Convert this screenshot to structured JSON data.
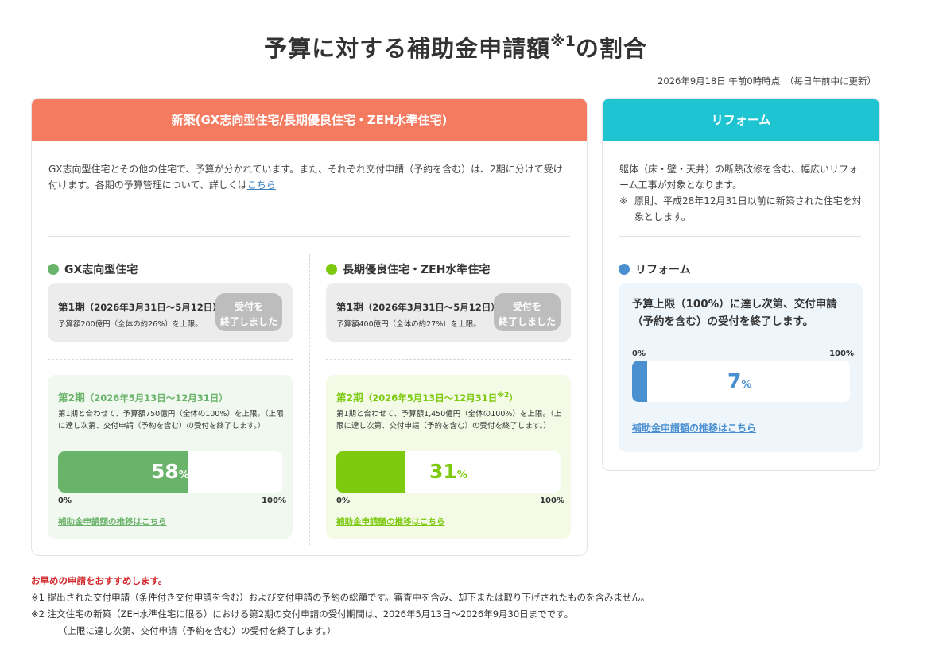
{
  "page": {
    "title_main": "予算に対する補助金申請額",
    "title_note": "※1",
    "title_tail": "の割合",
    "timestamp": "2026年9月18日 午前0時時点　（毎日午前中に更新）"
  },
  "new_build": {
    "header": "新築(GX志向型住宅/長期優良住宅・ZEH水準住宅)",
    "description": "GX志向型住宅とその他の住宅で、予算が分かれています。また、それぞれ交付申請（予約を含む）は、2期に分けて受け付けます。各期の予算管理について、詳しくは",
    "description_link": "こちら",
    "gx": {
      "title": "GX志向型住宅",
      "dot_color": "#6ab36a",
      "period1_title": "第1期",
      "period1_dates": "（2026年3月31日〜5月12日）",
      "period1_sub": "予算額200億円（全体の約26%）を上限。",
      "closed_label": "受付を終了しました",
      "period2_title": "第2期",
      "period2_dates": "（2026年5月13日〜12月31日）",
      "period2_desc": "第1期と合わせて、予算額750億円（全体の100%）を上限。（上限に達し次第、交付申請（予約を含む）の受付を終了します。）",
      "percent": 58,
      "percent_text": "58",
      "percent_unit": "%",
      "axis_min": "0%",
      "axis_max": "100%",
      "link": "補助金申請額の推移はこちら",
      "color": "#6ab36a",
      "bg_color": "#f0f8ef"
    },
    "zeh": {
      "title": "長期優良住宅・ZEH水準住宅",
      "dot_color": "#7cc90e",
      "period1_title": "第1期",
      "period1_dates": "（2026年3月31日〜5月12日）",
      "period1_sub": "予算額400億円（全体の約27%）を上限。",
      "closed_label": "受付を終了しました",
      "period2_title": "第2期",
      "period2_dates": "（2026年5月13日〜12月31日",
      "period2_note": "※2",
      "period2_dates_end": "）",
      "period2_desc": "第1期と合わせて、予算額1,450億円（全体の100%）を上限。（上限に達し次第、交付申請（予約を含む）の受付を終了します。）",
      "percent": 31,
      "percent_text": "31",
      "percent_unit": "%",
      "axis_min": "0%",
      "axis_max": "100%",
      "link": "補助金申請額の推移はこちら",
      "color": "#7cc90e",
      "bg_color": "#f3fbe6"
    }
  },
  "reform": {
    "header": "リフォーム",
    "description": "躯体（床・壁・天井）の断熱改修を含む、幅広いリフォーム工事が対象となります。",
    "note_mark": "※",
    "note_text": "原則、平成28年12月31日以前に新築された住宅を対象とします。",
    "section_title": "リフォーム",
    "dot_color": "#4a90d0",
    "box_text": "予算上限（100%）に達し次第、交付申請（予約を含む）の受付を終了します。",
    "percent": 7,
    "percent_text": "7",
    "percent_unit": "%",
    "axis_min": "0%",
    "axis_max": "100%",
    "link": "補助金申請額の推移はこちら",
    "color": "#4a90d0"
  },
  "footer": {
    "recommend": "お早めの申請をおすすめします。",
    "note1": "※1 提出された交付申請（条件付き交付申請を含む）および交付申請の予約の総額です。審査中を含み、却下または取り下げされたものを含みません。",
    "note2": "※2 注文住宅の新築（ZEH水準住宅に限る）における第2期の交付申請の受付期間は、2026年5月13日〜2026年9月30日までです。",
    "note2_cont": "（上限に達し次第、交付申請（予約を含む）の受付を終了します。）"
  }
}
